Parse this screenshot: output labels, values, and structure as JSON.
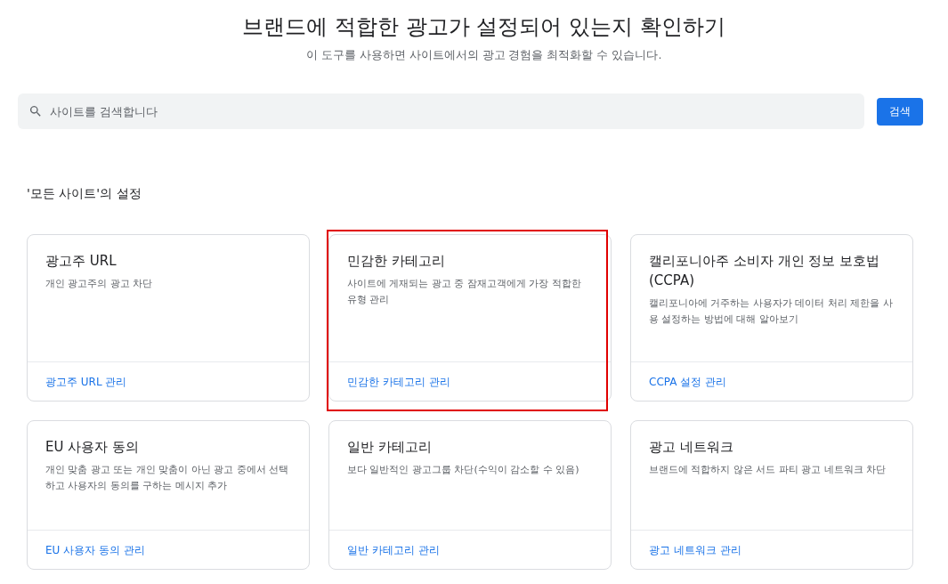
{
  "header": {
    "title": "브랜드에 적합한 광고가 설정되어 있는지 확인하기",
    "subtitle": "이 도구를 사용하면 사이트에서의 광고 경험을 최적화할 수 있습니다."
  },
  "search": {
    "placeholder": "사이트를 검색합니다",
    "button": "검색"
  },
  "section": {
    "title": "'모든 사이트'의 설정"
  },
  "cards": [
    {
      "title": "광고주 URL",
      "description": "개인 광고주의 광고 차단",
      "link": "광고주 URL 관리",
      "highlighted": false
    },
    {
      "title": "민감한 카테고리",
      "description": "사이트에 게재되는 광고 중 잠재고객에게 가장 적합한 유형 관리",
      "link": "민감한 카테고리 관리",
      "highlighted": true
    },
    {
      "title": "캘리포니아주 소비자 개인 정보 보호법 (CCPA)",
      "description": "캘리포니아에 거주하는 사용자가 데이터 처리 제한을 사용 설정하는 방법에 대해 알아보기",
      "link": "CCPA 설정 관리",
      "highlighted": false
    },
    {
      "title": "EU 사용자 동의",
      "description": "개인 맞춤 광고 또는 개인 맞춤이 아닌 광고 중에서 선택하고 사용자의 동의를 구하는 메시지 추가",
      "link": "EU 사용자 동의 관리",
      "highlighted": false
    },
    {
      "title": "일반 카테고리",
      "description": "보다 일반적인 광고그룹 차단(수익이 감소할 수 있음)",
      "link": "일반 카테고리 관리",
      "highlighted": false
    },
    {
      "title": "광고 네트워크",
      "description": "브랜드에 적합하지 않은 서드 파티 광고 네트워크 차단",
      "link": "광고 네트워크 관리",
      "highlighted": false
    }
  ]
}
